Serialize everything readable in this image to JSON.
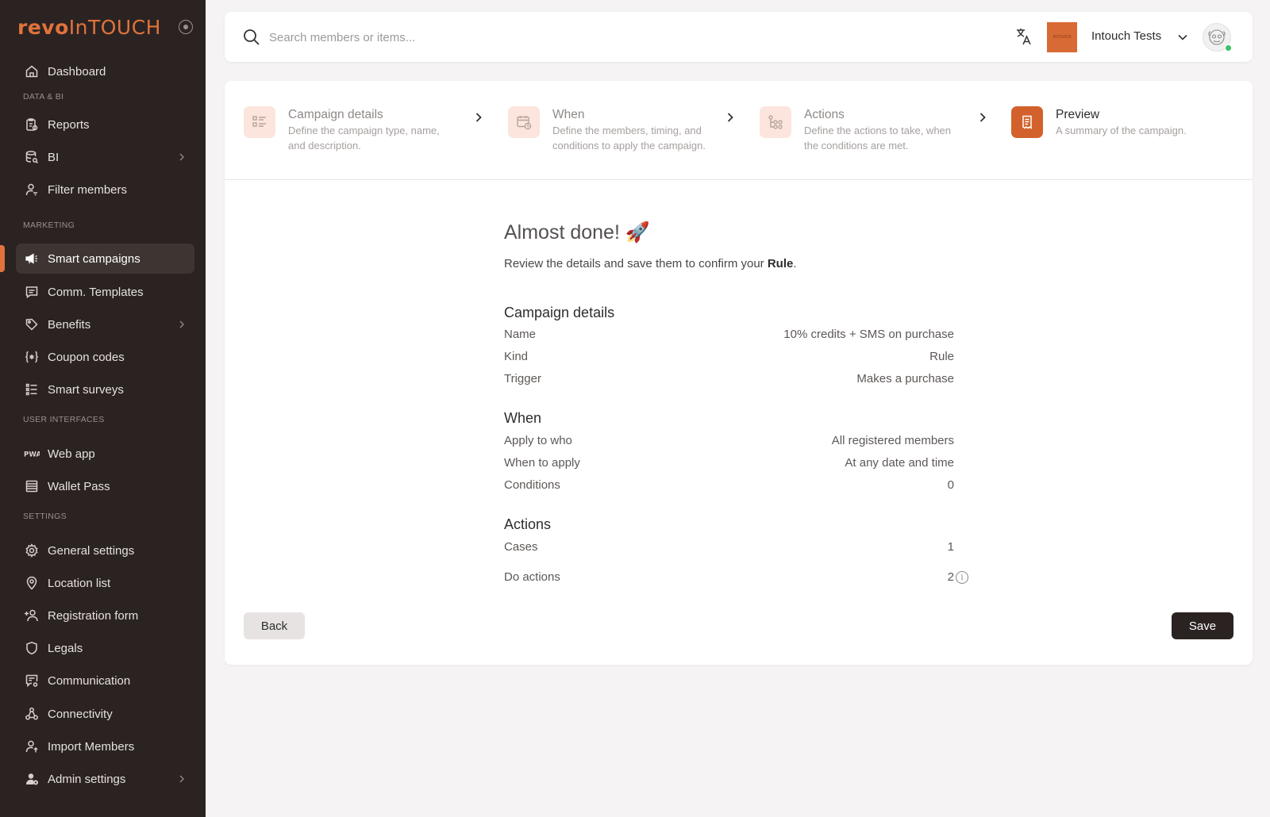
{
  "brand": {
    "logo_revo": "revo",
    "logo_intouch": "InTOUCH",
    "accent": "#E0733C"
  },
  "sidebar": {
    "items": [
      {
        "label": "Dashboard",
        "icon": "home-icon"
      },
      {
        "section": "DATA & BI"
      },
      {
        "label": "Reports",
        "icon": "report-icon"
      },
      {
        "label": "BI",
        "icon": "database-icon",
        "has_submenu": true
      },
      {
        "label": "Filter members",
        "icon": "user-filter-icon"
      },
      {
        "section": "MARKETING"
      },
      {
        "label": "Smart campaigns",
        "icon": "megaphone-icon",
        "active": true
      },
      {
        "label": "Comm. Templates",
        "icon": "message-icon"
      },
      {
        "label": "Benefits",
        "icon": "tag-icon",
        "has_submenu": true
      },
      {
        "label": "Coupon codes",
        "icon": "coupon-icon"
      },
      {
        "label": "Smart surveys",
        "icon": "list-icon"
      },
      {
        "section": "USER INTERFACES"
      },
      {
        "label": "Web app",
        "icon": "pwa-icon"
      },
      {
        "label": "Wallet Pass",
        "icon": "wallet-icon"
      },
      {
        "section": "SETTINGS"
      },
      {
        "label": "General settings",
        "icon": "gear-icon"
      },
      {
        "label": "Location list",
        "icon": "location-pin-icon"
      },
      {
        "label": "Registration form",
        "icon": "user-plus-icon"
      },
      {
        "label": "Legals",
        "icon": "shield-icon"
      },
      {
        "label": "Communication",
        "icon": "chat-settings-icon"
      },
      {
        "label": "Connectivity",
        "icon": "connectivity-icon"
      },
      {
        "label": "Import Members",
        "icon": "user-import-icon"
      },
      {
        "label": "Admin settings",
        "icon": "admin-icon",
        "has_submenu": true
      }
    ]
  },
  "topbar": {
    "search_placeholder": "Search members or items...",
    "org_logo_text": "INTOUCH",
    "org_name": "Intouch Tests"
  },
  "stepper": {
    "steps": [
      {
        "title": "Campaign details",
        "desc_line1": "Define the campaign type, name,",
        "desc_line2": "and description."
      },
      {
        "title": "When",
        "desc_line1": "Define the members, timing, and",
        "desc_line2": "conditions to apply the campaign."
      },
      {
        "title": "Actions",
        "desc_line1": "Define the actions to take, when",
        "desc_line2": "the conditions are met."
      },
      {
        "title": "Preview",
        "desc_line1": "A summary of the campaign.",
        "desc_line2": "",
        "current": true
      }
    ]
  },
  "preview": {
    "heading": "Almost done! 🚀",
    "intro_prefix": "Review the details and save them to confirm your ",
    "intro_bold": "Rule",
    "intro_suffix": ".",
    "campaign_details": {
      "title": "Campaign details",
      "rows": [
        {
          "label": "Name",
          "value": "10% credits + SMS on purchase"
        },
        {
          "label": "Kind",
          "value": "Rule"
        },
        {
          "label": "Trigger",
          "value": "Makes a purchase"
        }
      ]
    },
    "when": {
      "title": "When",
      "rows": [
        {
          "label": "Apply to who",
          "value": "All registered members"
        },
        {
          "label": "When to apply",
          "value": "At any date and time"
        },
        {
          "label": "Conditions",
          "value": "0"
        }
      ]
    },
    "actions": {
      "title": "Actions",
      "rows": [
        {
          "label": "Cases",
          "value": "1"
        },
        {
          "label": "Do actions",
          "value": "2"
        }
      ]
    }
  },
  "buttons": {
    "back": "Back",
    "save": "Save"
  }
}
